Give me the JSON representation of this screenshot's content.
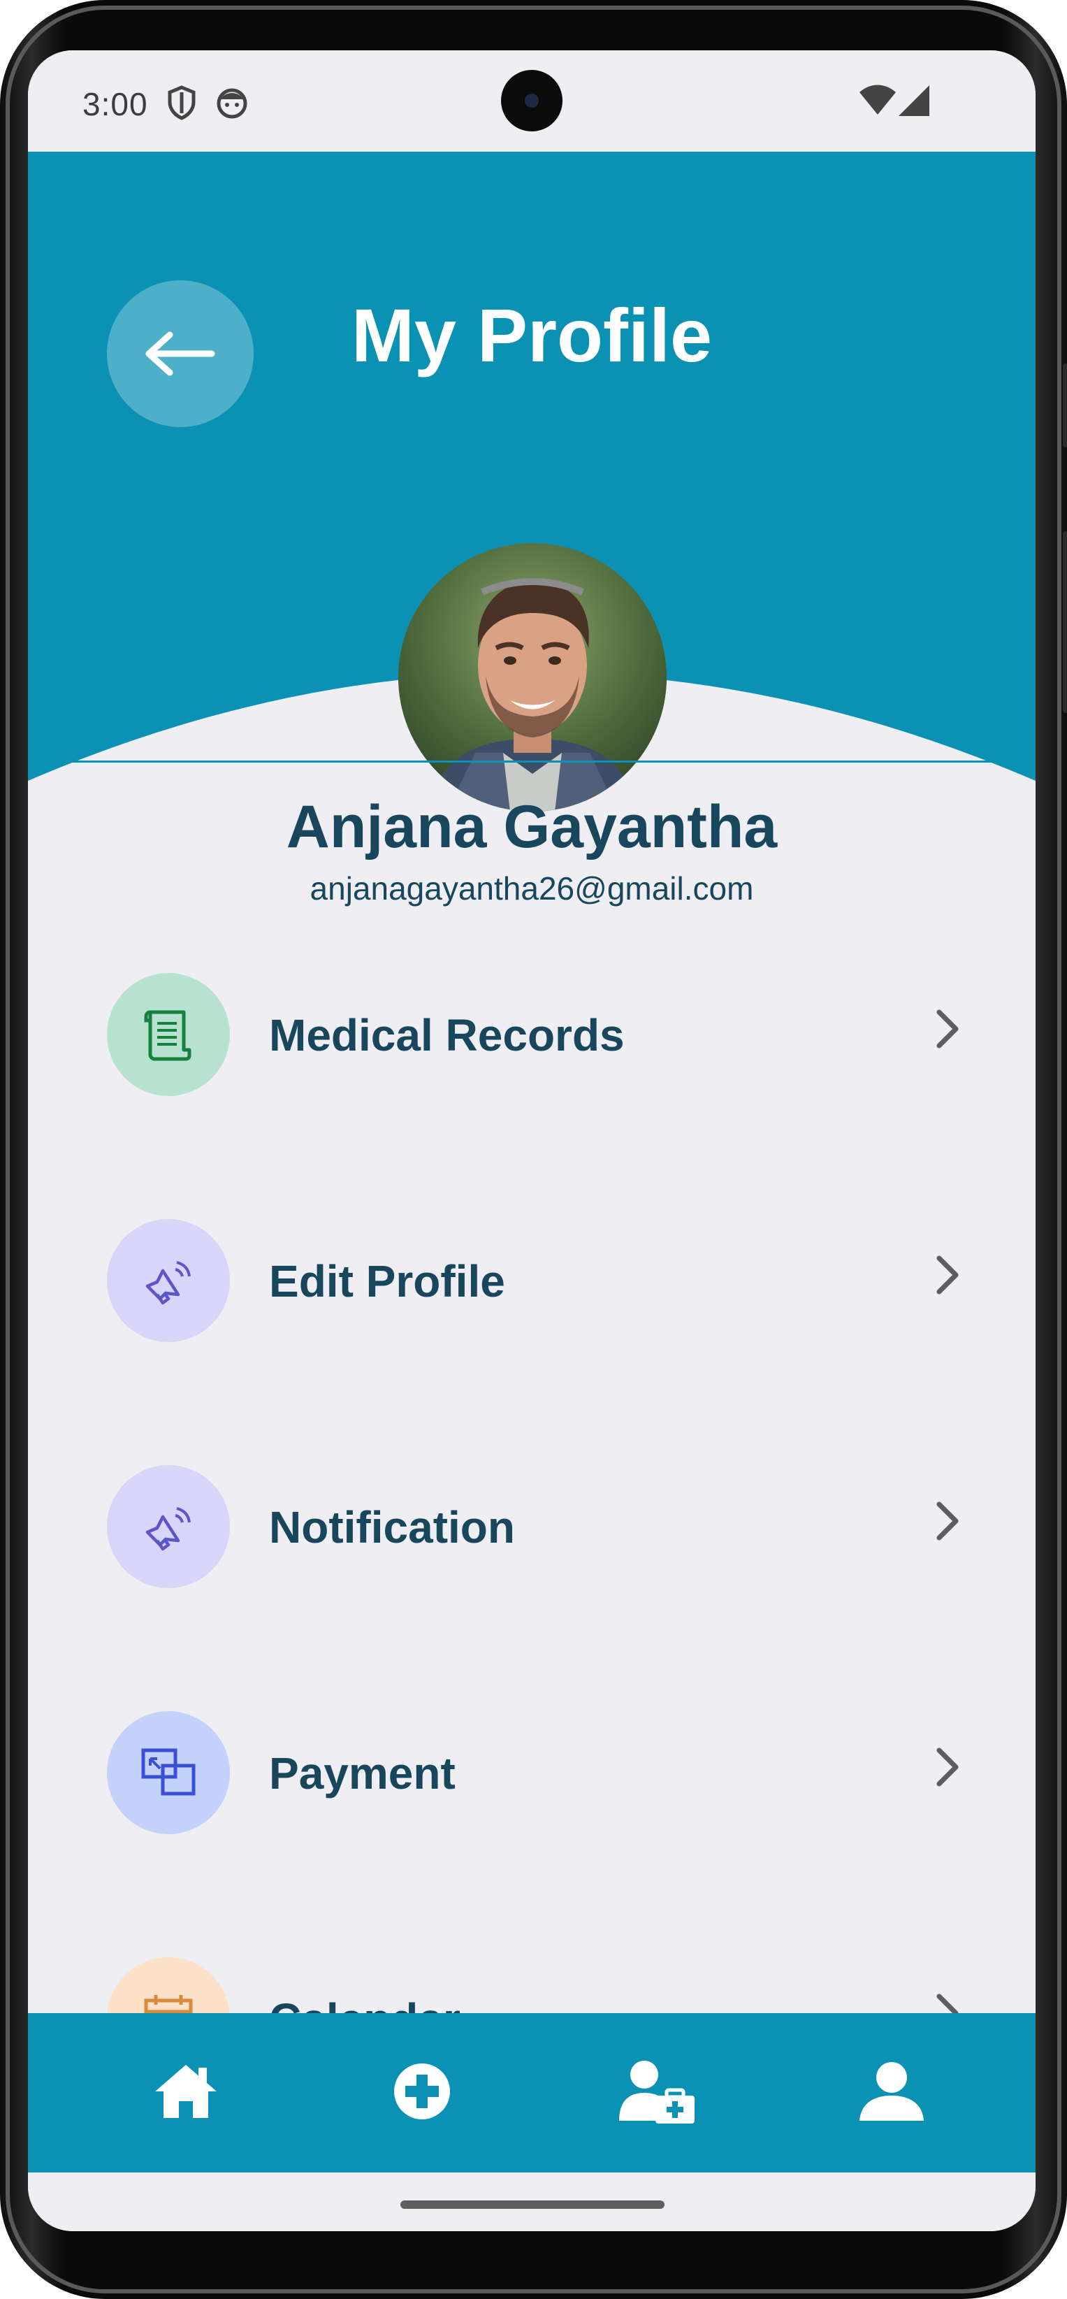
{
  "status_bar": {
    "time": "3:00",
    "icons": [
      "shield-icon",
      "face-icon",
      "wifi-icon",
      "signal-icon"
    ]
  },
  "header": {
    "title": "My Profile",
    "back_icon": "arrow-left-icon",
    "background_color": "#0a91b3"
  },
  "profile": {
    "name": "Anjana Gayantha",
    "email": "anjanagayantha26@gmail.com"
  },
  "menu": {
    "items": [
      {
        "label": "Medical Records",
        "icon": "document-icon",
        "icon_bg": "#b8e2d0",
        "icon_color": "#16803f"
      },
      {
        "label": "Edit Profile",
        "icon": "megaphone-icon",
        "icon_bg": "#d7d5f8",
        "icon_color": "#5c55c9"
      },
      {
        "label": "Notification",
        "icon": "megaphone-icon",
        "icon_bg": "#d7d5f8",
        "icon_color": "#5c55c9"
      },
      {
        "label": "Payment",
        "icon": "window-restore-icon",
        "icon_bg": "#c3d2fb",
        "icon_color": "#3b4fd6"
      },
      {
        "label": "Calendar",
        "icon": "calendar-icon",
        "icon_bg": "#fde1c8",
        "icon_color": "#d98a3a"
      }
    ],
    "chevron_icon": "chevron-right-icon"
  },
  "bottom_nav": {
    "items": [
      "home-icon",
      "add-circle-icon",
      "doctor-icon",
      "user-icon"
    ],
    "background_color": "#0a91b3"
  }
}
